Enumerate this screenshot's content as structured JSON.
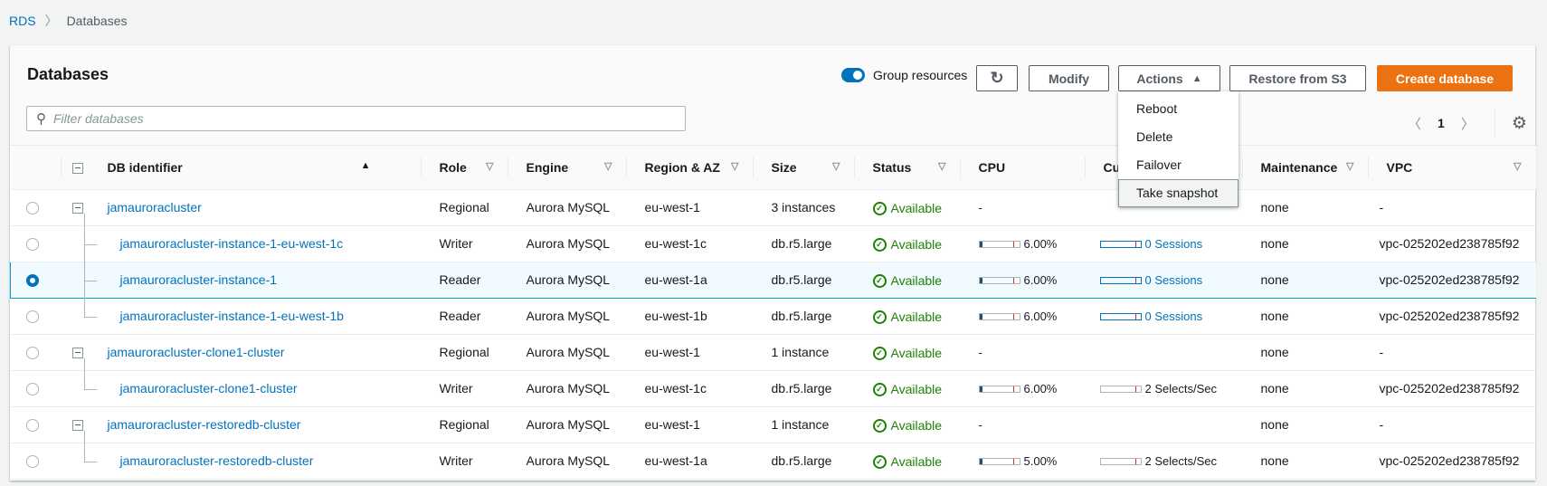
{
  "breadcrumb": {
    "root": "RDS",
    "current": "Databases"
  },
  "panel": {
    "title": "Databases",
    "group_resources_label": "Group resources",
    "group_resources_on": true
  },
  "toolbar": {
    "refresh_icon": "refresh-icon",
    "modify": "Modify",
    "actions": "Actions",
    "restore": "Restore from S3",
    "create": "Create database"
  },
  "actions_menu": {
    "items": [
      "Reboot",
      "Delete",
      "Failover",
      "Take snapshot"
    ],
    "highlighted": "Take snapshot"
  },
  "filter": {
    "placeholder": "Filter databases",
    "value": ""
  },
  "pagination": {
    "page": "1"
  },
  "colors": {
    "accent": "#0073bb",
    "primary": "#ec7211",
    "available": "#1d8102",
    "selected_row": "#f1faff"
  },
  "columns": [
    "DB identifier",
    "Role",
    "Engine",
    "Region & AZ",
    "Size",
    "Status",
    "CPU",
    "Current activity",
    "Maintenance",
    "VPC"
  ],
  "rows": [
    {
      "id": "jamauroracluster",
      "role": "Regional",
      "engine": "Aurora MySQL",
      "region": "eu-west-1",
      "size": "3 instances",
      "status": "Available",
      "cpu": "-",
      "activity": "",
      "maintenance": "none",
      "vpc": "-",
      "level": 0,
      "selected": false
    },
    {
      "id": "jamauroracluster-instance-1-eu-west-1c",
      "role": "Writer",
      "engine": "Aurora MySQL",
      "region": "eu-west-1c",
      "size": "db.r5.large",
      "status": "Available",
      "cpu": "6.00%",
      "activity": "0 Sessions",
      "activity_type": "sessions",
      "maintenance": "none",
      "vpc": "vpc-025202ed238785f92",
      "level": 1,
      "selected": false
    },
    {
      "id": "jamauroracluster-instance-1",
      "role": "Reader",
      "engine": "Aurora MySQL",
      "region": "eu-west-1a",
      "size": "db.r5.large",
      "status": "Available",
      "cpu": "6.00%",
      "activity": "0 Sessions",
      "activity_type": "sessions",
      "maintenance": "none",
      "vpc": "vpc-025202ed238785f92",
      "level": 1,
      "selected": true
    },
    {
      "id": "jamauroracluster-instance-1-eu-west-1b",
      "role": "Reader",
      "engine": "Aurora MySQL",
      "region": "eu-west-1b",
      "size": "db.r5.large",
      "status": "Available",
      "cpu": "6.00%",
      "activity": "0 Sessions",
      "activity_type": "sessions",
      "maintenance": "none",
      "vpc": "vpc-025202ed238785f92",
      "level": 1,
      "selected": false
    },
    {
      "id": "jamauroracluster-clone1-cluster",
      "role": "Regional",
      "engine": "Aurora MySQL",
      "region": "eu-west-1",
      "size": "1 instance",
      "status": "Available",
      "cpu": "-",
      "activity": "",
      "maintenance": "none",
      "vpc": "-",
      "level": 0,
      "selected": false
    },
    {
      "id": "jamauroracluster-clone1-cluster",
      "role": "Writer",
      "engine": "Aurora MySQL",
      "region": "eu-west-1c",
      "size": "db.r5.large",
      "status": "Available",
      "cpu": "6.00%",
      "activity": "2 Selects/Sec",
      "activity_type": "selects",
      "maintenance": "none",
      "vpc": "vpc-025202ed238785f92",
      "level": 1,
      "selected": false
    },
    {
      "id": "jamauroracluster-restoredb-cluster",
      "role": "Regional",
      "engine": "Aurora MySQL",
      "region": "eu-west-1",
      "size": "1 instance",
      "status": "Available",
      "cpu": "-",
      "activity": "",
      "maintenance": "none",
      "vpc": "-",
      "level": 0,
      "selected": false
    },
    {
      "id": "jamauroracluster-restoredb-cluster",
      "role": "Writer",
      "engine": "Aurora MySQL",
      "region": "eu-west-1a",
      "size": "db.r5.large",
      "status": "Available",
      "cpu": "5.00%",
      "activity": "2 Selects/Sec",
      "activity_type": "selects",
      "maintenance": "none",
      "vpc": "vpc-025202ed238785f92",
      "level": 1,
      "selected": false
    }
  ]
}
